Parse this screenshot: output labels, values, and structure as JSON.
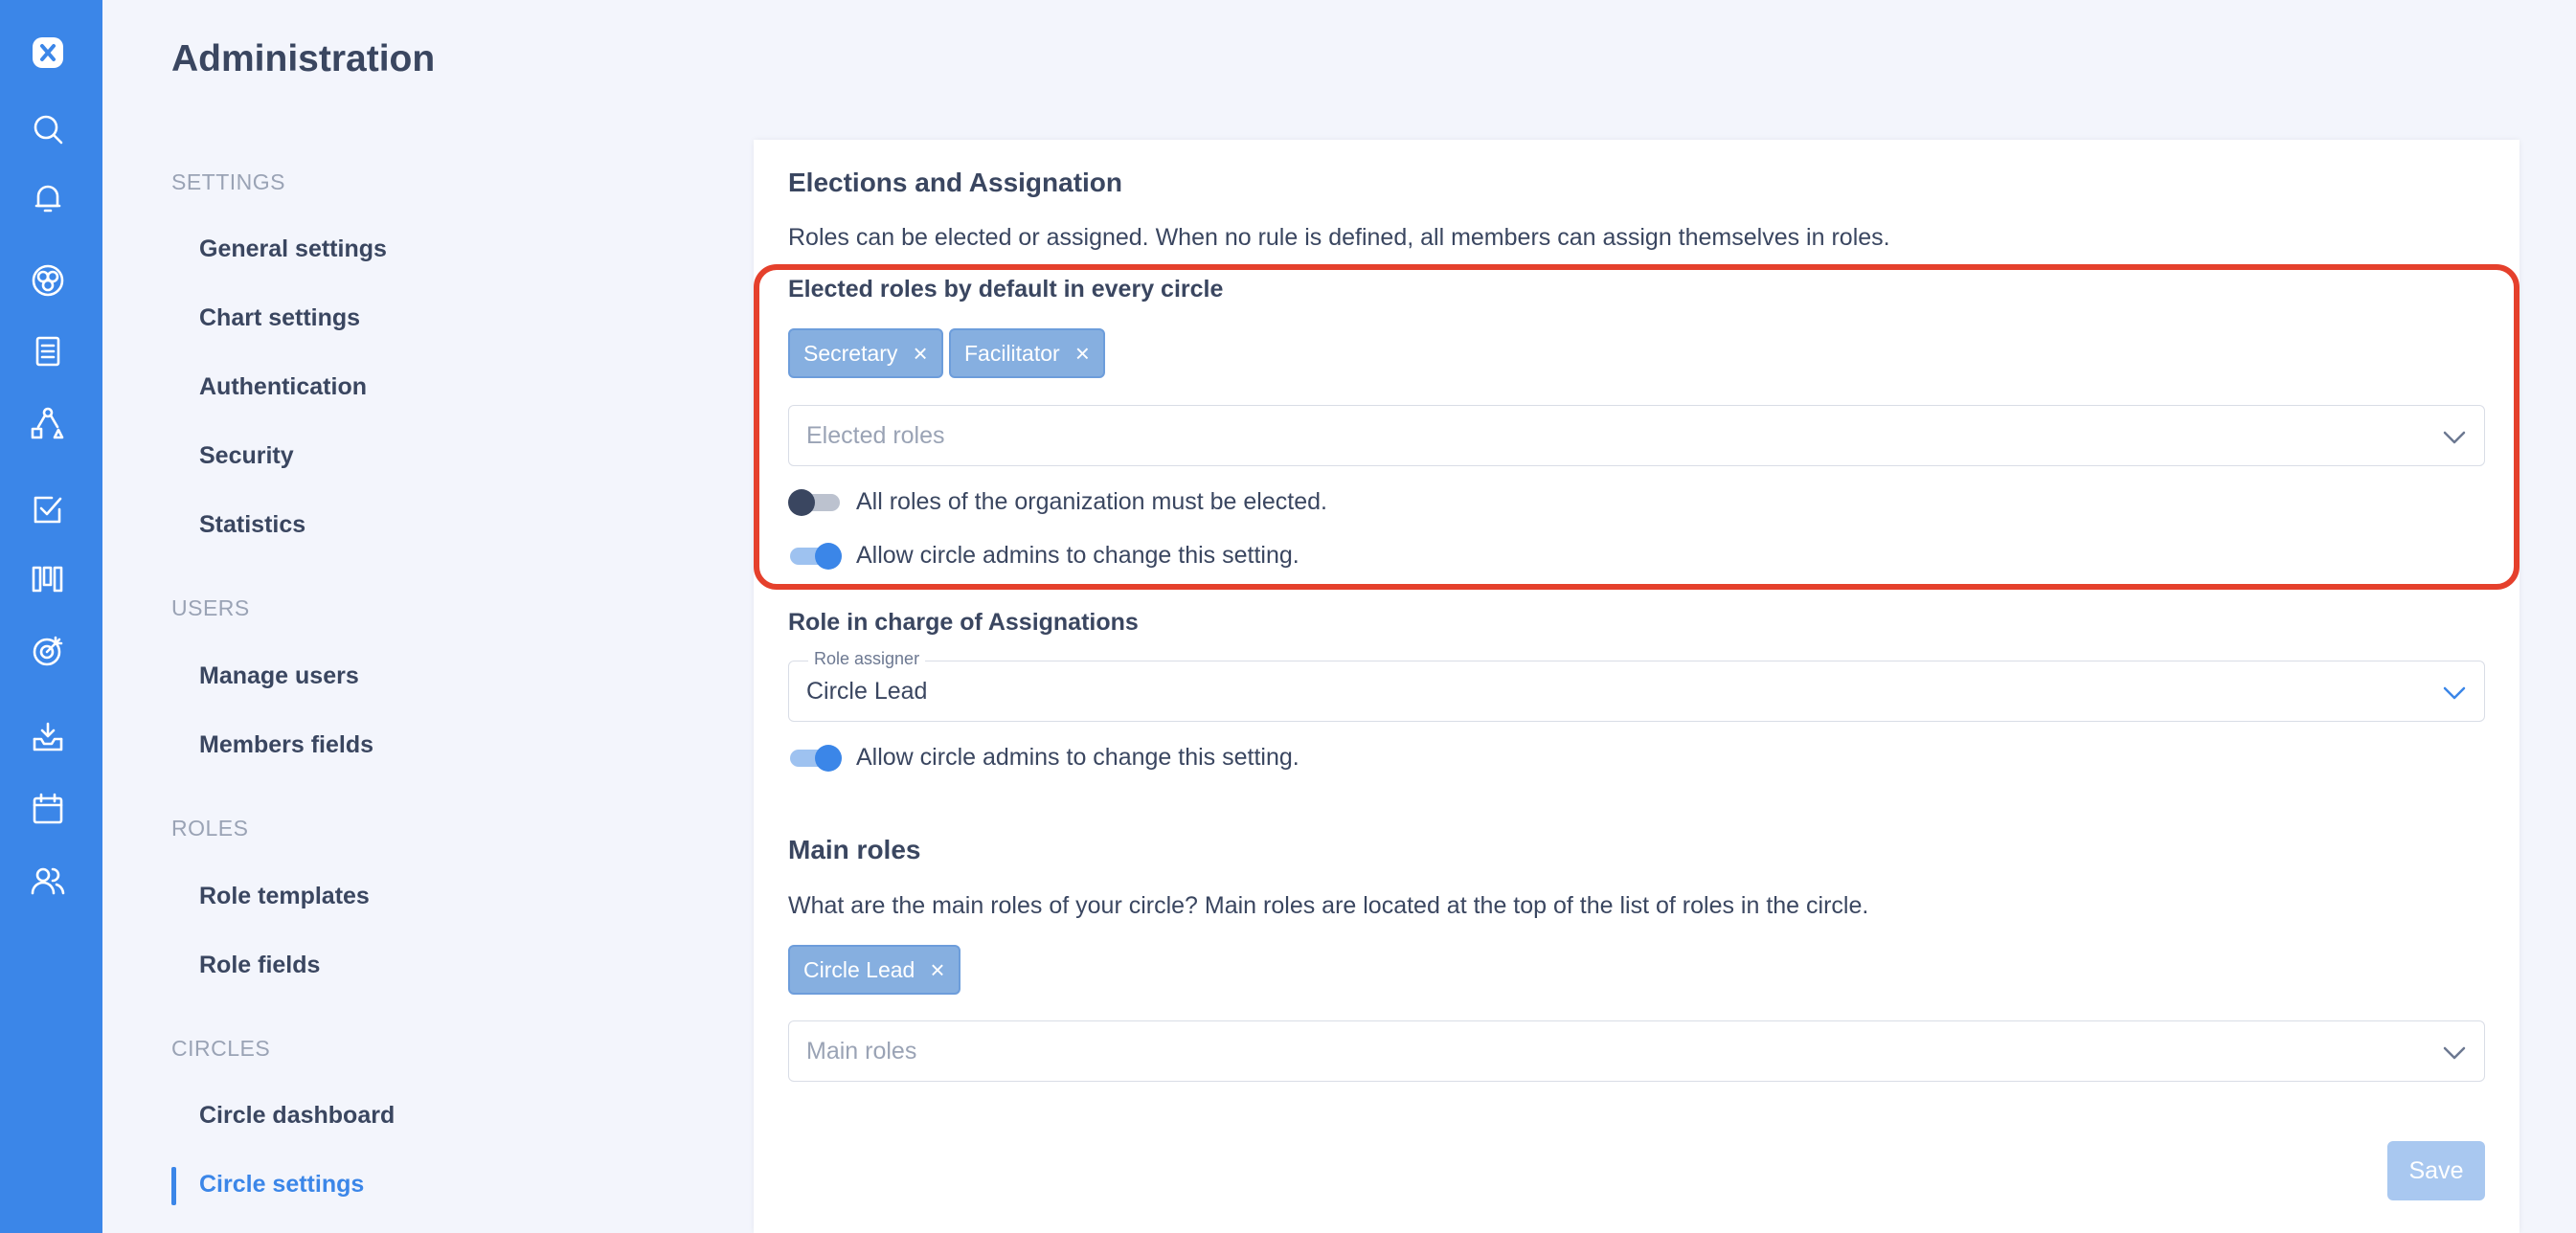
{
  "rail": {
    "icons": [
      "logo-icon",
      "search-icon",
      "bell-icon",
      "chart-icon",
      "document-icon",
      "shapes-icon",
      "checkbox-icon",
      "kanban-icon",
      "target-icon",
      "inbox-icon",
      "calendar-icon",
      "users-icon"
    ]
  },
  "page": {
    "title": "Administration"
  },
  "nav": {
    "sections": [
      {
        "title": "SETTINGS",
        "items": [
          "General settings",
          "Chart settings",
          "Authentication",
          "Security",
          "Statistics"
        ]
      },
      {
        "title": "USERS",
        "items": [
          "Manage users",
          "Members fields"
        ]
      },
      {
        "title": "ROLES",
        "items": [
          "Role templates",
          "Role fields"
        ]
      },
      {
        "title": "CIRCLES",
        "items": [
          "Circle dashboard",
          "Circle settings"
        ]
      }
    ],
    "active": "Circle settings"
  },
  "elections": {
    "title": "Elections and Assignation",
    "description": "Roles can be elected or assigned. When no rule is defined, all members can assign themselves in roles.",
    "elected": {
      "title": "Elected roles by default in every circle",
      "chips": [
        "Secretary",
        "Facilitator"
      ],
      "placeholder": "Elected roles",
      "toggle_all_label": "All roles of the organization must be elected.",
      "toggle_all_on": false,
      "toggle_admins_label": "Allow circle admins to change this setting.",
      "toggle_admins_on": true
    },
    "assignation": {
      "title": "Role in charge of Assignations",
      "field_label": "Role assigner",
      "value": "Circle Lead",
      "toggle_admins_label": "Allow circle admins to change this setting.",
      "toggle_admins_on": true
    }
  },
  "main_roles": {
    "title": "Main roles",
    "description": "What are the main roles of your circle? Main roles are located at the top of the list of roles in the circle.",
    "chips": [
      "Circle Lead"
    ],
    "placeholder": "Main roles"
  },
  "actions": {
    "save_label": "Save"
  },
  "colors": {
    "accent": "#3b86e8",
    "highlight": "#e5402c",
    "chip": "#86afe0"
  }
}
